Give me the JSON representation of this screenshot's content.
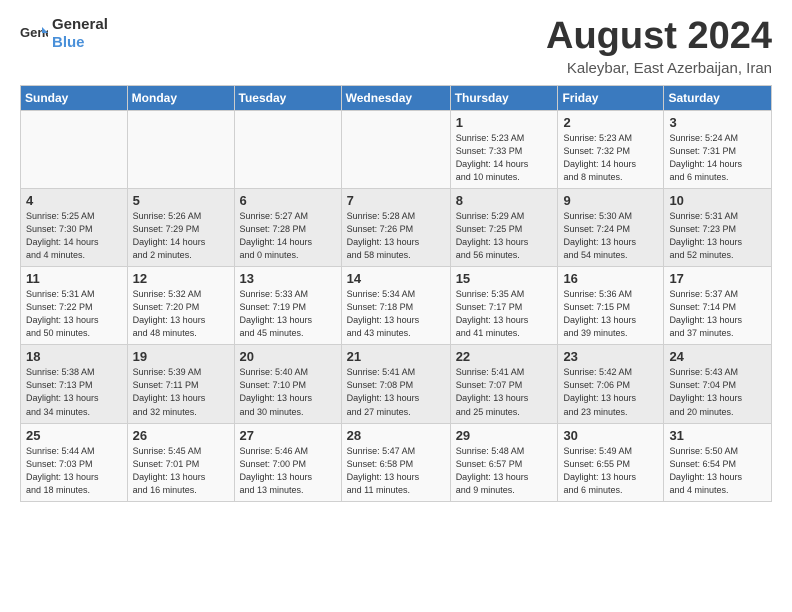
{
  "header": {
    "logo_general": "General",
    "logo_blue": "Blue",
    "title": "August 2024",
    "location": "Kaleybar, East Azerbaijan, Iran"
  },
  "days_of_week": [
    "Sunday",
    "Monday",
    "Tuesday",
    "Wednesday",
    "Thursday",
    "Friday",
    "Saturday"
  ],
  "weeks": [
    [
      {
        "num": "",
        "info": ""
      },
      {
        "num": "",
        "info": ""
      },
      {
        "num": "",
        "info": ""
      },
      {
        "num": "",
        "info": ""
      },
      {
        "num": "1",
        "info": "Sunrise: 5:23 AM\nSunset: 7:33 PM\nDaylight: 14 hours\nand 10 minutes."
      },
      {
        "num": "2",
        "info": "Sunrise: 5:23 AM\nSunset: 7:32 PM\nDaylight: 14 hours\nand 8 minutes."
      },
      {
        "num": "3",
        "info": "Sunrise: 5:24 AM\nSunset: 7:31 PM\nDaylight: 14 hours\nand 6 minutes."
      }
    ],
    [
      {
        "num": "4",
        "info": "Sunrise: 5:25 AM\nSunset: 7:30 PM\nDaylight: 14 hours\nand 4 minutes."
      },
      {
        "num": "5",
        "info": "Sunrise: 5:26 AM\nSunset: 7:29 PM\nDaylight: 14 hours\nand 2 minutes."
      },
      {
        "num": "6",
        "info": "Sunrise: 5:27 AM\nSunset: 7:28 PM\nDaylight: 14 hours\nand 0 minutes."
      },
      {
        "num": "7",
        "info": "Sunrise: 5:28 AM\nSunset: 7:26 PM\nDaylight: 13 hours\nand 58 minutes."
      },
      {
        "num": "8",
        "info": "Sunrise: 5:29 AM\nSunset: 7:25 PM\nDaylight: 13 hours\nand 56 minutes."
      },
      {
        "num": "9",
        "info": "Sunrise: 5:30 AM\nSunset: 7:24 PM\nDaylight: 13 hours\nand 54 minutes."
      },
      {
        "num": "10",
        "info": "Sunrise: 5:31 AM\nSunset: 7:23 PM\nDaylight: 13 hours\nand 52 minutes."
      }
    ],
    [
      {
        "num": "11",
        "info": "Sunrise: 5:31 AM\nSunset: 7:22 PM\nDaylight: 13 hours\nand 50 minutes."
      },
      {
        "num": "12",
        "info": "Sunrise: 5:32 AM\nSunset: 7:20 PM\nDaylight: 13 hours\nand 48 minutes."
      },
      {
        "num": "13",
        "info": "Sunrise: 5:33 AM\nSunset: 7:19 PM\nDaylight: 13 hours\nand 45 minutes."
      },
      {
        "num": "14",
        "info": "Sunrise: 5:34 AM\nSunset: 7:18 PM\nDaylight: 13 hours\nand 43 minutes."
      },
      {
        "num": "15",
        "info": "Sunrise: 5:35 AM\nSunset: 7:17 PM\nDaylight: 13 hours\nand 41 minutes."
      },
      {
        "num": "16",
        "info": "Sunrise: 5:36 AM\nSunset: 7:15 PM\nDaylight: 13 hours\nand 39 minutes."
      },
      {
        "num": "17",
        "info": "Sunrise: 5:37 AM\nSunset: 7:14 PM\nDaylight: 13 hours\nand 37 minutes."
      }
    ],
    [
      {
        "num": "18",
        "info": "Sunrise: 5:38 AM\nSunset: 7:13 PM\nDaylight: 13 hours\nand 34 minutes."
      },
      {
        "num": "19",
        "info": "Sunrise: 5:39 AM\nSunset: 7:11 PM\nDaylight: 13 hours\nand 32 minutes."
      },
      {
        "num": "20",
        "info": "Sunrise: 5:40 AM\nSunset: 7:10 PM\nDaylight: 13 hours\nand 30 minutes."
      },
      {
        "num": "21",
        "info": "Sunrise: 5:41 AM\nSunset: 7:08 PM\nDaylight: 13 hours\nand 27 minutes."
      },
      {
        "num": "22",
        "info": "Sunrise: 5:41 AM\nSunset: 7:07 PM\nDaylight: 13 hours\nand 25 minutes."
      },
      {
        "num": "23",
        "info": "Sunrise: 5:42 AM\nSunset: 7:06 PM\nDaylight: 13 hours\nand 23 minutes."
      },
      {
        "num": "24",
        "info": "Sunrise: 5:43 AM\nSunset: 7:04 PM\nDaylight: 13 hours\nand 20 minutes."
      }
    ],
    [
      {
        "num": "25",
        "info": "Sunrise: 5:44 AM\nSunset: 7:03 PM\nDaylight: 13 hours\nand 18 minutes."
      },
      {
        "num": "26",
        "info": "Sunrise: 5:45 AM\nSunset: 7:01 PM\nDaylight: 13 hours\nand 16 minutes."
      },
      {
        "num": "27",
        "info": "Sunrise: 5:46 AM\nSunset: 7:00 PM\nDaylight: 13 hours\nand 13 minutes."
      },
      {
        "num": "28",
        "info": "Sunrise: 5:47 AM\nSunset: 6:58 PM\nDaylight: 13 hours\nand 11 minutes."
      },
      {
        "num": "29",
        "info": "Sunrise: 5:48 AM\nSunset: 6:57 PM\nDaylight: 13 hours\nand 9 minutes."
      },
      {
        "num": "30",
        "info": "Sunrise: 5:49 AM\nSunset: 6:55 PM\nDaylight: 13 hours\nand 6 minutes."
      },
      {
        "num": "31",
        "info": "Sunrise: 5:50 AM\nSunset: 6:54 PM\nDaylight: 13 hours\nand 4 minutes."
      }
    ]
  ]
}
